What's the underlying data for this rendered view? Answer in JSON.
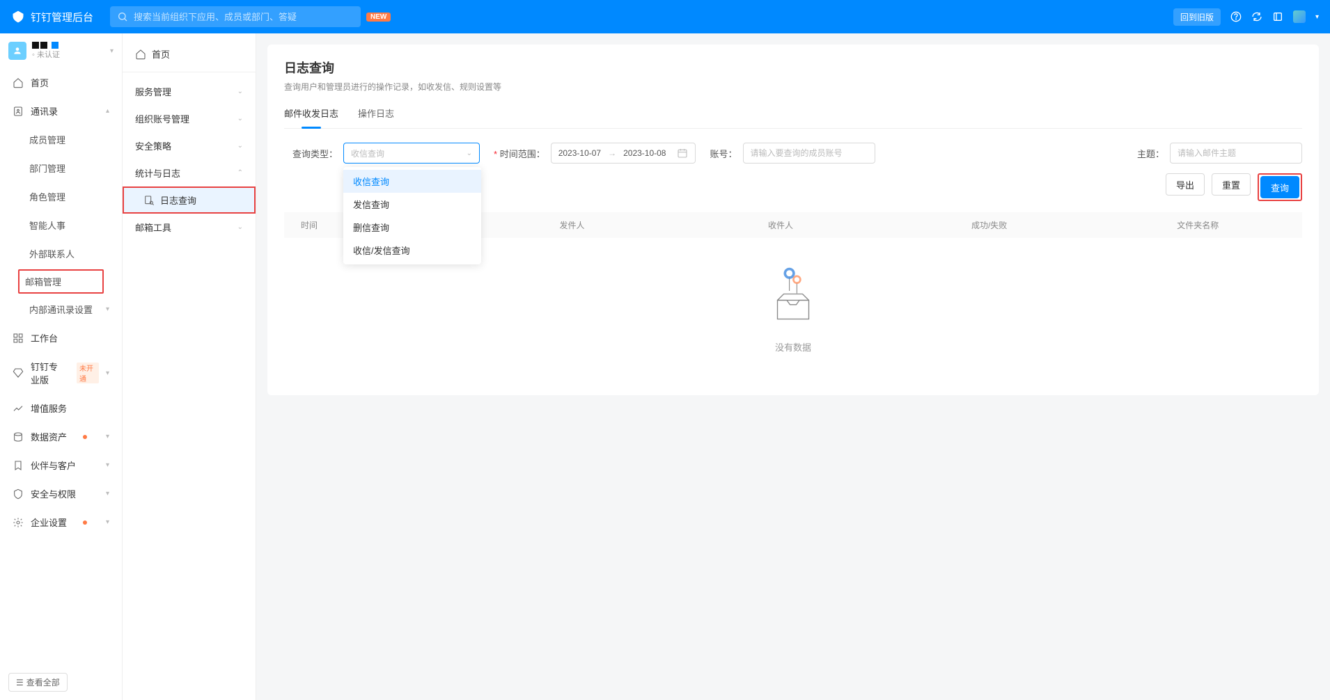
{
  "header": {
    "app_title": "钉钉管理后台",
    "search_placeholder": "搜索当前组织下应用、成员或部门、答疑",
    "new_badge": "NEW",
    "old_version_btn": "回到旧版"
  },
  "org": {
    "status": "未认证"
  },
  "main_nav": {
    "home": "首页",
    "contacts": "通讯录",
    "member_mgmt": "成员管理",
    "dept_mgmt": "部门管理",
    "role_mgmt": "角色管理",
    "smart_hr": "智能人事",
    "external_contacts": "外部联系人",
    "mail_mgmt": "邮箱管理",
    "internal_contacts_setting": "内部通讯录设置",
    "workbench": "工作台",
    "pro_edition": "钉钉专业版",
    "pro_badge": "未开通",
    "value_added": "增值服务",
    "data_assets": "数据资产",
    "partners": "伙伴与客户",
    "security": "安全与权限",
    "enterprise_settings": "企业设置",
    "view_all": "查看全部"
  },
  "sub_nav": {
    "home": "首页",
    "service_mgmt": "服务管理",
    "org_account_mgmt": "组织账号管理",
    "security_policy": "安全策略",
    "stats_logs": "统计与日志",
    "log_query": "日志查询",
    "mailbox_tools": "邮箱工具"
  },
  "page": {
    "title": "日志查询",
    "subtitle": "查询用户和管理员进行的操作记录，如收发信、规则设置等"
  },
  "tabs": {
    "mail_log": "邮件收发日志",
    "operation_log": "操作日志"
  },
  "filters": {
    "query_type_label": "查询类型：",
    "query_type_placeholder": "收信查询",
    "date_range_label": "时间范围：",
    "date_start": "2023-10-07",
    "date_end": "2023-10-08",
    "account_label": "账号：",
    "account_placeholder": "请输入要查询的成员账号",
    "subject_label": "主题：",
    "subject_placeholder": "请输入邮件主题"
  },
  "dropdown_options": {
    "opt1": "收信查询",
    "opt2": "发信查询",
    "opt3": "删信查询",
    "opt4": "收信/发信查询"
  },
  "actions": {
    "export": "导出",
    "reset": "重置",
    "query": "查询"
  },
  "table": {
    "col_time": "时间",
    "col_sender": "发件人",
    "col_recipient": "收件人",
    "col_status": "成功/失败",
    "col_folder": "文件夹名称"
  },
  "empty": {
    "text": "没有数据"
  }
}
